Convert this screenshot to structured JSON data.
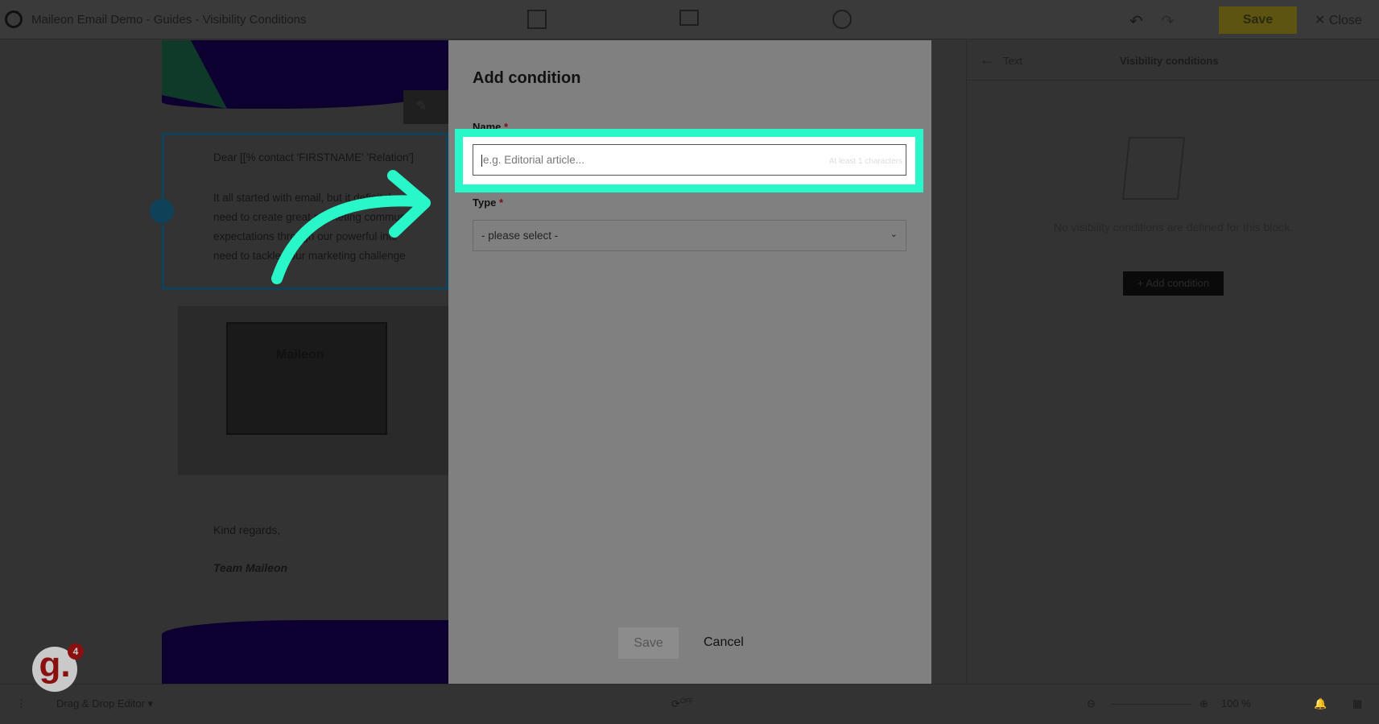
{
  "topbar": {
    "title": "Maileon Email Demo - Guides - Visibility Conditions",
    "save": "Save",
    "close": "Close",
    "undo": "↶",
    "redo": "↷"
  },
  "email": {
    "greeting": "Dear [[% contact 'FIRSTNAME' 'Relation']",
    "lines": [
      "It all started with email, but it definitely",
      "need to create great marketing communi",
      "expectations through our powerful inte",
      "need to tackle your marketing challenge"
    ],
    "photo_brand": "Maileon",
    "closing": "Kind regards,",
    "signature": "Team Maileon"
  },
  "right_panel": {
    "back_label": "Text",
    "title": "Visibility conditions",
    "empty": "No visibility conditions are defined for this block.",
    "add_button": "+ Add condition"
  },
  "dialog": {
    "title": "Add condition",
    "name_label": "Name",
    "required": "*",
    "name_placeholder": "e.g. Editorial article...",
    "name_hint": "At least 1 characters",
    "type_label": "Type",
    "type_value": "- please select -",
    "save": "Save",
    "cancel": "Cancel"
  },
  "bottombar": {
    "editor": "Drag & Drop Editor",
    "autosave": "OFF",
    "zoom": "100 %"
  },
  "guide_badge": {
    "letter": "g.",
    "count": "4"
  },
  "colors": {
    "highlight": "#2af7c9",
    "dialog_bg": "#808080",
    "overlay": "#333333"
  }
}
